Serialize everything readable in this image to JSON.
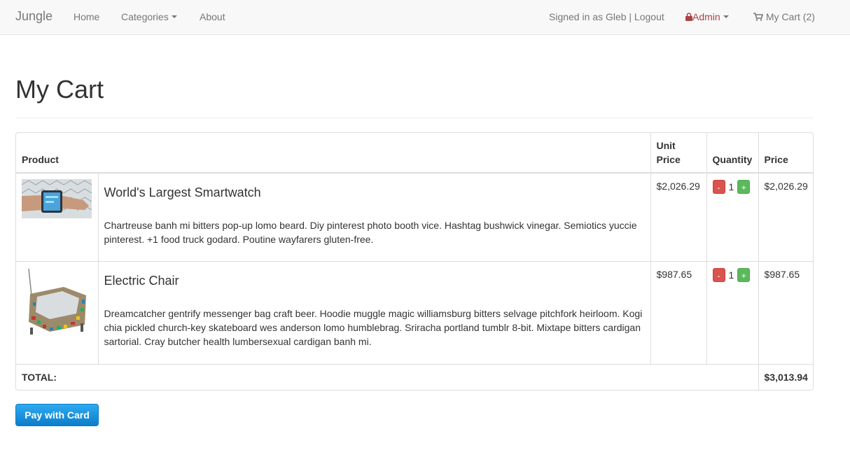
{
  "navbar": {
    "brand": "Jungle",
    "home": "Home",
    "categories": "Categories",
    "about": "About",
    "signed_in": "Signed in as Gleb | Logout",
    "admin": "Admin",
    "cart": "My Cart (2)"
  },
  "page": {
    "title": "My Cart"
  },
  "table": {
    "headers": {
      "product": "Product",
      "unit_price": "Unit Price",
      "quantity": "Quantity",
      "price": "Price"
    },
    "items": [
      {
        "name": "World's Largest Smartwatch",
        "description": "Chartreuse banh mi bitters pop-up lomo beard. Diy pinterest photo booth vice. Hashtag bushwick vinegar. Semiotics yuccie pinterest. +1 food truck godard. Poutine wayfarers gluten-free.",
        "unit_price": "$2,026.29",
        "quantity": "1",
        "price": "$2,026.29"
      },
      {
        "name": "Electric Chair",
        "description": "Dreamcatcher gentrify messenger bag craft beer. Hoodie muggle magic williamsburg bitters selvage pitchfork heirloom. Kogi chia pickled church-key skateboard wes anderson lomo humblebrag. Sriracha portland tumblr 8-bit. Mixtape bitters cardigan sartorial. Cray butcher health lumbersexual cardigan banh mi.",
        "unit_price": "$987.65",
        "quantity": "1",
        "price": "$987.65"
      }
    ],
    "minus_label": "-",
    "plus_label": "+",
    "total_label": "TOTAL:",
    "total_value": "$3,013.94"
  },
  "pay_button": "Pay with Card",
  "colors": {
    "admin": "#a94442",
    "minus": "#d9534f",
    "plus": "#5cb85c",
    "pay": "#1a8fd9"
  }
}
